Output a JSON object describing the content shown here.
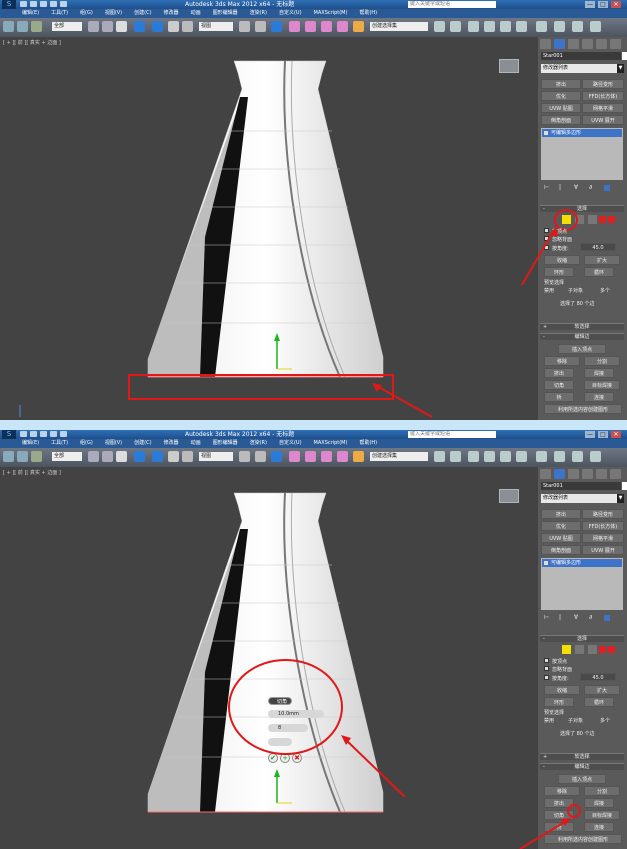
{
  "app": {
    "title": "Autodesk 3ds Max  2012 x64  - 无标题",
    "search_placeholder": "键入关键字或短语",
    "window_buttons": [
      "—",
      "□",
      "✕"
    ]
  },
  "menu": [
    "编辑(E)",
    "工具(T)",
    "组(G)",
    "视图(V)",
    "创建(C)",
    "修改器",
    "动画",
    "图形编辑器",
    "渲染(R)",
    "自定义(U)",
    "MAXScript(M)",
    "帮助(H)"
  ],
  "toolbar": {
    "selection_filter": "全部",
    "coord_system": "视图",
    "named_selection": "创建选择集"
  },
  "viewport": {
    "label": "[ + ][ 前 ][ 真实 + 边面 ]"
  },
  "panel": {
    "object_name": "Star001",
    "modifier_list": "修改器列表",
    "buttons": [
      "挤出",
      "路径变形",
      "优化",
      "FFD(长方体)",
      "UVW 贴图",
      "网格平滑",
      "倒角剖面",
      "UVW 展开"
    ],
    "stack_item": "可编辑多边形",
    "selection_rollout": "选择",
    "by_vertex": "按顶点",
    "ignore_backfacing": "忽略背面",
    "by_angle": "按角度:",
    "angle_value": "45.0",
    "shrink": "收缩",
    "grow": "扩大",
    "ring": "环形",
    "loop": "循环",
    "preview_selection": "预览选择",
    "preview_options": [
      "禁用",
      "子对象",
      "多个"
    ],
    "selection_status": "选择了 80 个边",
    "soft_selection": "软选择",
    "edit_edges": "编辑边",
    "insert_vertex": "插入顶点",
    "remove": "移除",
    "split": "分割",
    "extrude": "挤出",
    "weld": "焊接",
    "chamfer": "切角",
    "target_weld": "目标焊接",
    "bridge": "桥",
    "connect": "连接",
    "create_shape": "利用所选内容创建图形"
  },
  "caddy": {
    "title": "切角",
    "amount": "10.0mm",
    "segments": "8",
    "ok_icons": [
      "✔",
      "+",
      "✖"
    ]
  },
  "colors": {
    "annotation_red": "#e01818",
    "stack_blue": "#3d74c8",
    "title_blue": "#2f6fb5"
  }
}
